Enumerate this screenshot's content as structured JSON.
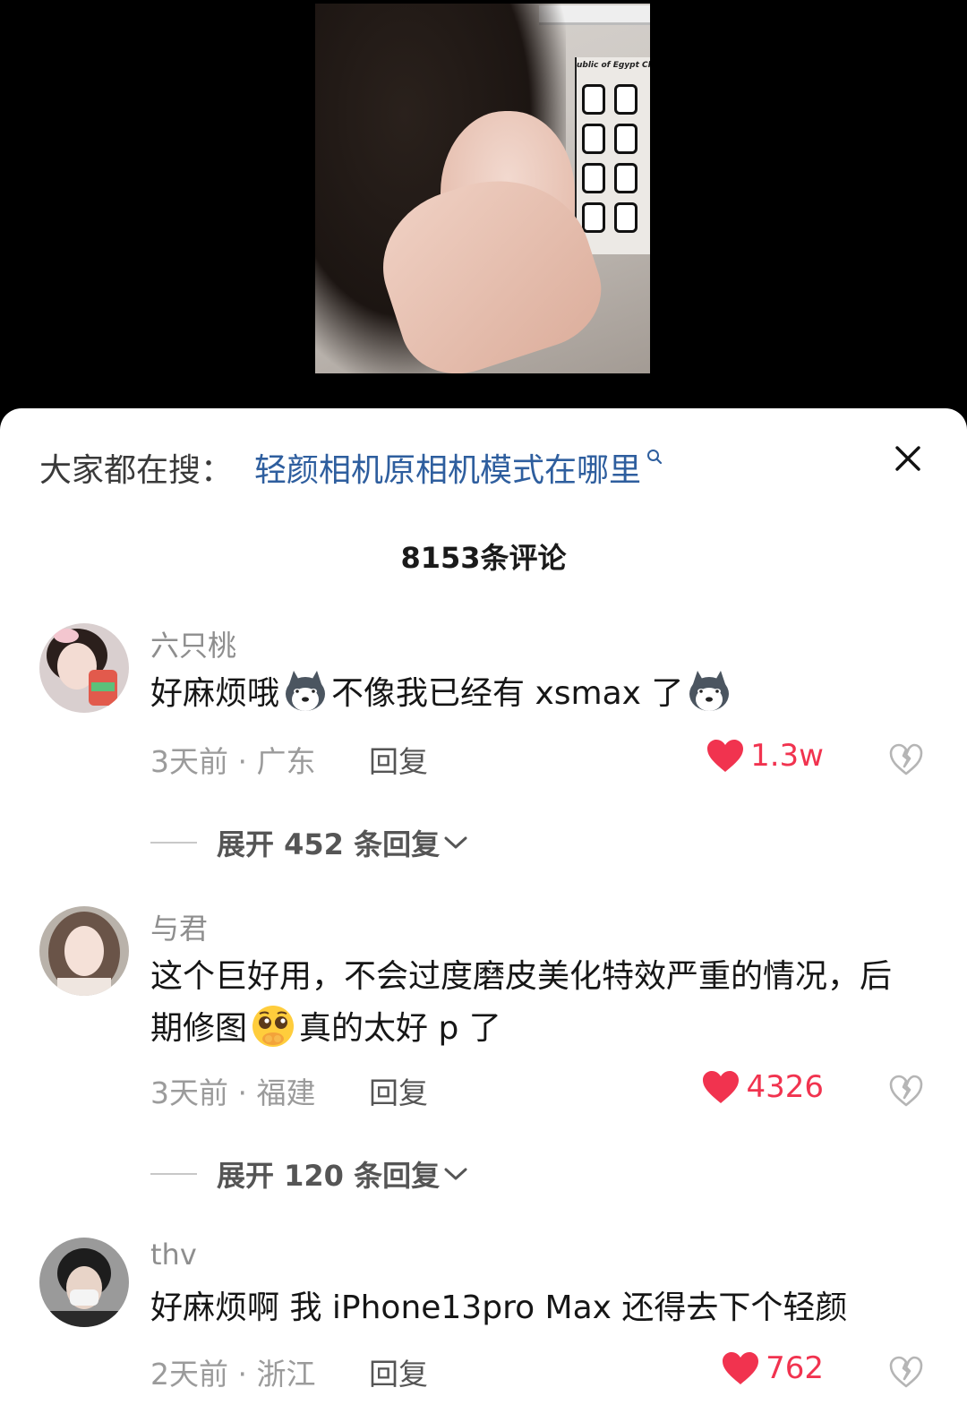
{
  "search": {
    "label": "大家都在搜：",
    "query": "轻颜相机原相机模式在哪里"
  },
  "comment_count": "8153条评论",
  "video": {
    "poster_caption": "ublic of Egypt Cha"
  },
  "comments": [
    {
      "username": "六只桃",
      "text_parts": [
        "好麻烦哦",
        "不像我已经有 xsmax 了"
      ],
      "emojis": [
        "husky-emoji",
        "husky-emoji"
      ],
      "meta": "3天前 · 广东",
      "reply_label": "回复",
      "likes": "1.3w",
      "expand_label": "展开 452 条回复"
    },
    {
      "username": "与君",
      "text_parts": [
        "这个巨好用，不会过度磨皮美化特效严重的情况，后期修图",
        "真的太好 p 了"
      ],
      "emojis": [
        "pleading-face-emoji"
      ],
      "meta": "3天前 · 福建",
      "reply_label": "回复",
      "likes": "4326",
      "expand_label": "展开 120 条回复"
    },
    {
      "username": "thv",
      "text_parts": [
        "好麻烦啊 我 iPhone13pro Max 还得去下个轻颜"
      ],
      "meta": "2天前 · 浙江",
      "reply_label": "回复",
      "likes": "762"
    }
  ],
  "colors": {
    "accent_like": "#f1334f",
    "search_link": "#2e5e9e"
  }
}
